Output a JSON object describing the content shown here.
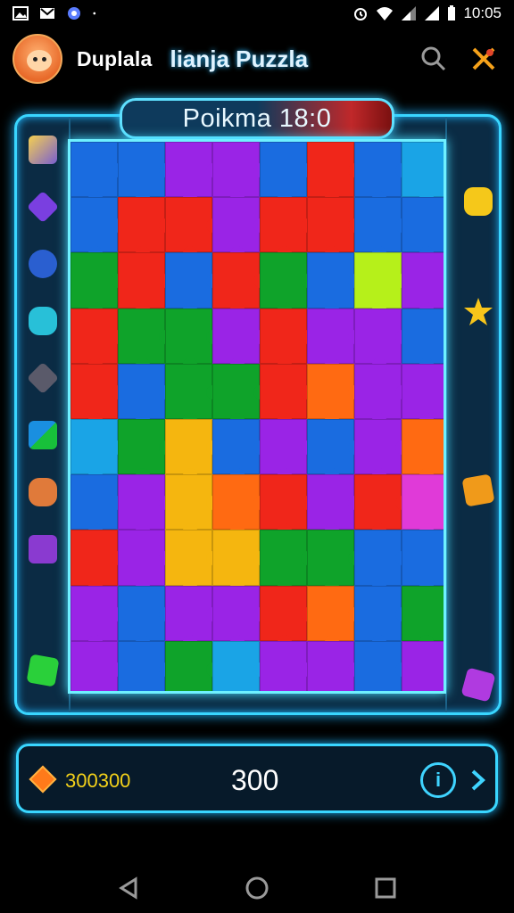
{
  "status_bar": {
    "time": "10:05",
    "left_icons": [
      "image-icon",
      "mail-icon",
      "browser-icon",
      "dot-icon"
    ],
    "right_icons": [
      "alarm-icon",
      "wifi-icon",
      "signal-icon",
      "battery-icon"
    ]
  },
  "header": {
    "app_name": "Duplala",
    "subtitle": "lianja Puzzla",
    "search_icon": "search-icon",
    "tools_icon": "tools-icon"
  },
  "level": {
    "label": "Poikma 18:0"
  },
  "side_left": [
    "tool-brush",
    "purple-gem",
    "blue-gear",
    "teal-creature",
    "grey-block",
    "green-flag",
    "orange-creature",
    "purple-box",
    "green-tile"
  ],
  "side_right": [
    "yellow-creature",
    "yellow-star",
    "orange-box",
    "purple-tile"
  ],
  "board": {
    "cols": 8,
    "rows": 10,
    "colors": {
      "R": "#f0261a",
      "G": "#0fa32a",
      "B": "#1a6ce0",
      "P": "#9a24e6",
      "Y": "#f5b60f",
      "L": "#b6f01a",
      "O": "#ff6a12",
      "M": "#e03ad8",
      "C": "#1aa4e6"
    },
    "rows_data": [
      "BBPPBRBC",
      "BRRPRRBB",
      "GRBRGBLP",
      "RGGPRPPB",
      "RBGGROPP",
      "CGYBPBPO",
      "BPYORPRM",
      "RPYYGGBB",
      "PBPPROBG",
      "PBGCPPBP"
    ]
  },
  "bottom_bar": {
    "coins": "300300",
    "score": "300",
    "info_label": "i",
    "gem_icon": "diamond-icon",
    "next_icon": "chevron-right-icon"
  },
  "nav": {
    "back": "back-icon",
    "home": "home-icon",
    "recents": "recents-icon"
  }
}
